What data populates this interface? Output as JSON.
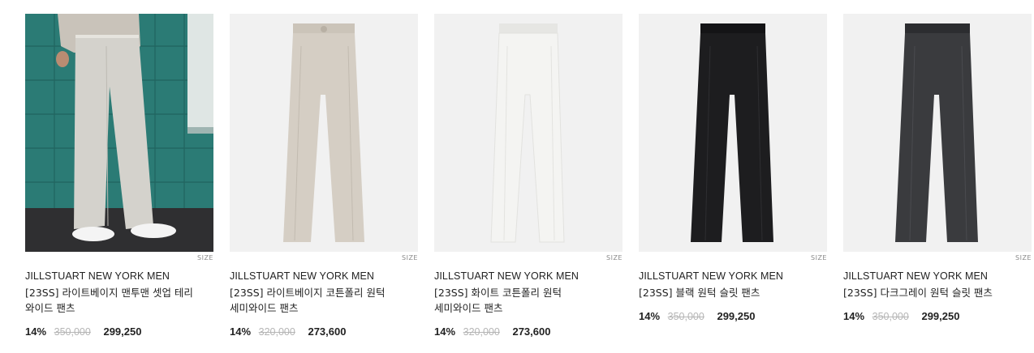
{
  "products": [
    {
      "brand": "JILLSTUART NEW YORK MEN",
      "name": "[23SS] 라이트베이지 맨투맨 셋업 테리 와이드 팬츠",
      "discount": "14%",
      "original_price": "350,000",
      "sale_price": "299,250",
      "size_label": "SIZE",
      "pants_color": "#d3d0c9"
    },
    {
      "brand": "JILLSTUART NEW YORK MEN",
      "name": "[23SS] 라이트베이지 코튼폴리 원턱 세미와이드 팬츠",
      "discount": "14%",
      "original_price": "320,000",
      "sale_price": "273,600",
      "size_label": "SIZE",
      "pants_color": "#d5cec4"
    },
    {
      "brand": "JILLSTUART NEW YORK MEN",
      "name": "[23SS] 화이트 코튼폴리 원턱 세미와이드 팬츠",
      "discount": "14%",
      "original_price": "320,000",
      "sale_price": "273,600",
      "size_label": "SIZE",
      "pants_color": "#f3f3f1"
    },
    {
      "brand": "JILLSTUART NEW YORK MEN",
      "name": "[23SS] 블랙 원턱 슬릿 팬츠",
      "discount": "14%",
      "original_price": "350,000",
      "sale_price": "299,250",
      "size_label": "SIZE",
      "pants_color": "#1d1d1f"
    },
    {
      "brand": "JILLSTUART NEW YORK MEN",
      "name": "[23SS] 다크그레이 원턱 슬릿 팬츠",
      "discount": "14%",
      "original_price": "350,000",
      "sale_price": "299,250",
      "size_label": "SIZE",
      "pants_color": "#3a3b3e"
    }
  ]
}
